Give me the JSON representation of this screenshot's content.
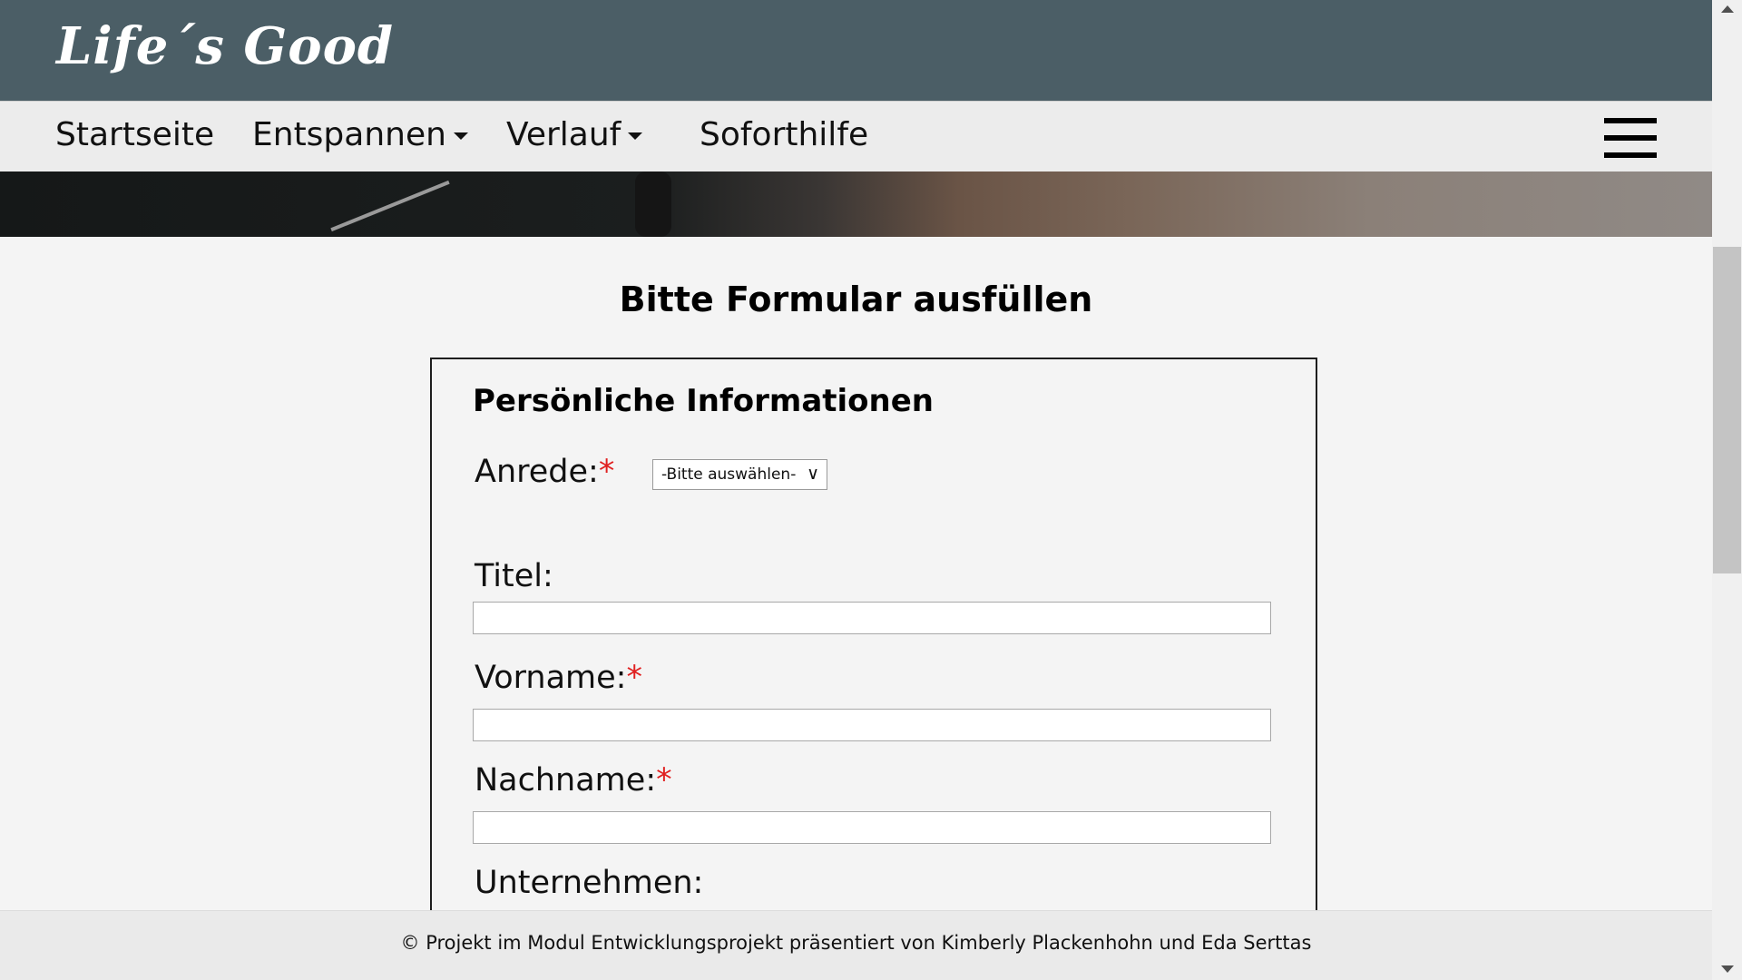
{
  "header": {
    "logo_text": "Life´s Good"
  },
  "nav": {
    "items": [
      {
        "label": "Startseite",
        "has_dropdown": false
      },
      {
        "label": "Entspannen",
        "has_dropdown": true
      },
      {
        "label": "Verlauf",
        "has_dropdown": true
      },
      {
        "label": "Soforthilfe",
        "has_dropdown": false
      }
    ],
    "menu_icon": "hamburger-menu-icon"
  },
  "main": {
    "title": "Bitte Formular ausfüllen",
    "section_title": "Persönliche Informationen",
    "fields": {
      "anrede": {
        "label": "Anrede:",
        "required_mark": "*",
        "selected": "-Bitte auswählen-"
      },
      "titel": {
        "label": "Titel:",
        "value": ""
      },
      "vorname": {
        "label": "Vorname:",
        "required_mark": "*",
        "value": ""
      },
      "nachname": {
        "label": "Nachname:",
        "required_mark": "*",
        "value": ""
      },
      "unternehmen": {
        "label": "Unternehmen:"
      }
    }
  },
  "footer": {
    "text": "© Projekt im Modul Entwicklungsprojekt präsentiert von Kimberly Plackenhohn und Eda Serttas"
  },
  "colors": {
    "header_bg": "#4b5e66",
    "nav_bg": "#ececec",
    "page_bg": "#f4f4f4",
    "required": "#e02020"
  }
}
